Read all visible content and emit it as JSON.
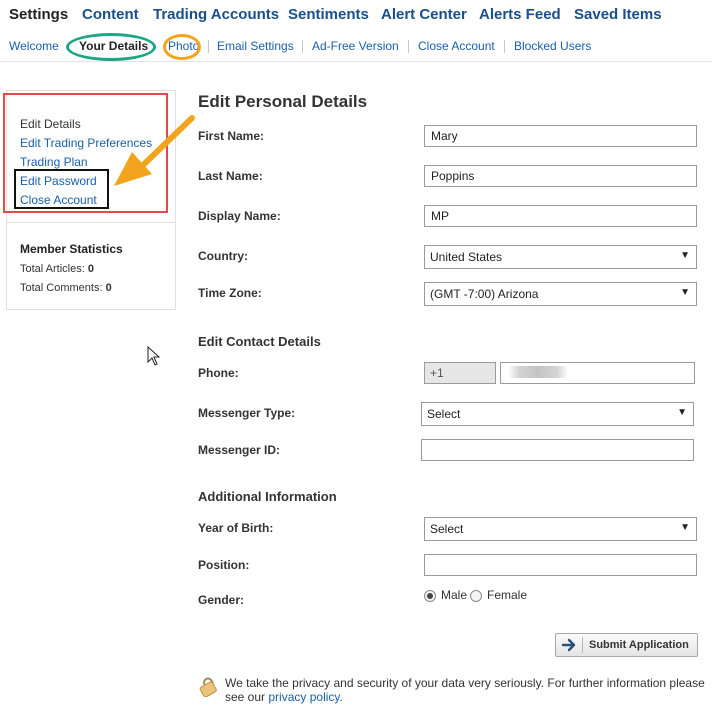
{
  "top_nav": [
    {
      "label": "Settings",
      "active": true
    },
    {
      "label": "Content"
    },
    {
      "label": "Trading Accounts"
    },
    {
      "label": "Sentiments"
    },
    {
      "label": "Alert Center"
    },
    {
      "label": "Alerts Feed"
    },
    {
      "label": "Saved Items"
    }
  ],
  "sub_nav": [
    {
      "label": "Welcome"
    },
    {
      "label": "Your Details",
      "active": true
    },
    {
      "label": "Photo"
    },
    {
      "label": "Email Settings"
    },
    {
      "label": "Ad-Free Version"
    },
    {
      "label": "Close Account"
    },
    {
      "label": "Blocked Users"
    }
  ],
  "sidebar": {
    "links": [
      "Edit Details",
      "Edit Trading Preferences",
      "Trading Plan",
      "Edit Password",
      "Close Account"
    ],
    "stats_title": "Member Statistics",
    "stats": [
      {
        "label": "Total Articles:",
        "value": "0"
      },
      {
        "label": "Total Comments:",
        "value": "0"
      }
    ]
  },
  "personal": {
    "title": "Edit Personal Details",
    "first_name_label": "First Name:",
    "first_name": "Mary",
    "last_name_label": "Last Name:",
    "last_name": "Poppins",
    "display_name_label": "Display Name:",
    "display_name": "MP",
    "country_label": "Country:",
    "country": "United States",
    "timezone_label": "Time Zone:",
    "timezone": "(GMT -7:00) Arizona"
  },
  "contact": {
    "title": "Edit Contact Details",
    "phone_label": "Phone:",
    "phone_prefix": "+1",
    "messenger_type_label": "Messenger Type:",
    "messenger_type": "Select",
    "messenger_id_label": "Messenger ID:"
  },
  "additional": {
    "title": "Additional Information",
    "year_label": "Year of Birth:",
    "year": "Select",
    "position_label": "Position:",
    "gender_label": "Gender:",
    "gender_options": [
      "Male",
      "Female"
    ],
    "gender_selected": "Male"
  },
  "submit_label": "Submit Application",
  "privacy": {
    "text": "We take the privacy and security of your data very seriously. For further information please see our",
    "link": "privacy policy",
    "end": "."
  },
  "colors": {
    "link": "#1a5fa8",
    "nav": "#1a4f8a",
    "highlight_green": "#1ea585",
    "highlight_orange": "#f2a51c",
    "highlight_red": "#e04a4a"
  },
  "icons": [
    "arrow-right-icon",
    "lock-icon",
    "chevron-down-icon",
    "mouse-cursor-icon",
    "annotation-arrow-icon"
  ]
}
